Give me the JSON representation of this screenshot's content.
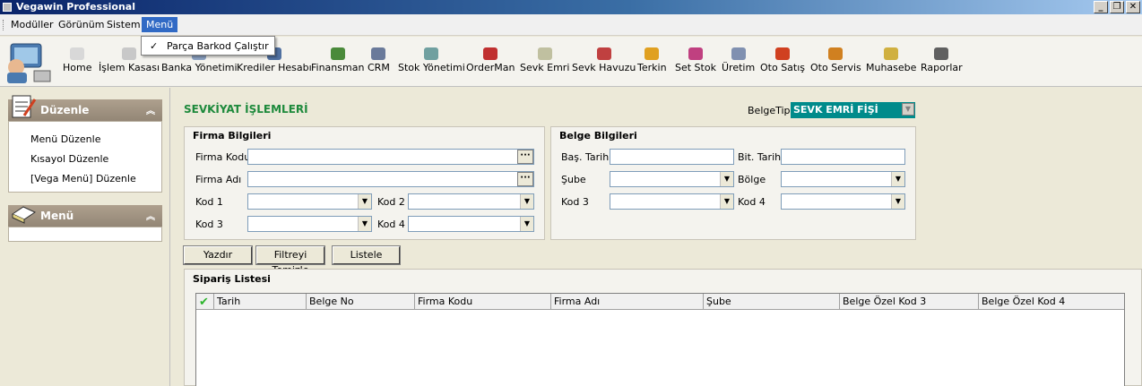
{
  "window": {
    "title": "Vegawin Professional",
    "minimize": "_",
    "restore": "❐",
    "close": "✕"
  },
  "menubar": {
    "items": [
      "Modüller",
      "Görünüm",
      "Sistem",
      "Menü"
    ]
  },
  "dropdown": {
    "items": [
      {
        "label": "Parça Barkod Çalıştır",
        "checked": "✓"
      }
    ]
  },
  "toolbar": {
    "items": [
      {
        "label": "Home",
        "icon": "home-icon",
        "color": "#d8d8d8"
      },
      {
        "label": "İşlem Kasası",
        "icon": "cash-register-icon",
        "color": "#c8c8c8"
      },
      {
        "label": "Banka Yönetimi",
        "icon": "bank-icon",
        "color": "#8aa0c0"
      },
      {
        "label": "Krediler Hesabı",
        "icon": "credit-icon",
        "color": "#5070a0"
      },
      {
        "label": "Finansman",
        "icon": "finance-icon",
        "color": "#4a8a3a"
      },
      {
        "label": "CRM",
        "icon": "crm-icon",
        "color": "#6a7a9a"
      },
      {
        "label": "Stok Yönetimi",
        "icon": "stock-icon",
        "color": "#70a0a0"
      },
      {
        "label": "OrderMan",
        "icon": "orderman-icon",
        "color": "#c03030"
      },
      {
        "label": "Sevk Emri",
        "icon": "dispatch-order-icon",
        "color": "#c0c0a0"
      },
      {
        "label": "Sevk Havuzu",
        "icon": "dispatch-pool-icon",
        "color": "#c04040"
      },
      {
        "label": "Terkin",
        "icon": "terkin-icon",
        "color": "#e0a020"
      },
      {
        "label": "Set Stok",
        "icon": "set-stock-icon",
        "color": "#c04080"
      },
      {
        "label": "Üretim",
        "icon": "production-icon",
        "color": "#8090b0"
      },
      {
        "label": "Oto Satış",
        "icon": "car-sales-icon",
        "color": "#d04020"
      },
      {
        "label": "Oto Servis",
        "icon": "car-service-icon",
        "color": "#d08020"
      },
      {
        "label": "Muhasebe",
        "icon": "accounting-icon",
        "color": "#d0b040"
      },
      {
        "label": "Raporlar",
        "icon": "reports-icon",
        "color": "#606060"
      }
    ]
  },
  "sidebar": {
    "sections": [
      {
        "title": "Düzenle",
        "chevron": "︽",
        "links": [
          "Menü Düzenle",
          "Kısayol Düzenle",
          "[Vega Menü] Düzenle"
        ]
      },
      {
        "title": "Menü",
        "chevron": "︽",
        "links": []
      }
    ]
  },
  "main": {
    "title": "SEVKİYAT İŞLEMLERİ",
    "belge_tipi": {
      "label": "BelgeTipi",
      "value": "SEVK EMRİ FİŞİ"
    },
    "firma": {
      "title": "Firma Bilgileri",
      "firma_kodu": "Firma Kodu",
      "firma_adi": "Firma Adı",
      "kod1": "Kod 1",
      "kod2": "Kod 2",
      "kod3": "Kod 3",
      "kod4": "Kod 4",
      "dots": "···"
    },
    "belge": {
      "title": "Belge Bilgileri",
      "bas_tarih": "Baş. Tarih",
      "bit_tarih": "Bit. Tarih",
      "sube": "Şube",
      "bolge": "Bölge",
      "kod3": "Kod 3",
      "kod4": "Kod 4"
    },
    "buttons": {
      "yazdir": "Yazdır",
      "filtre": "Filtreyi Temizle",
      "listele": "Listele"
    },
    "list": {
      "title": "Sipariş Listesi",
      "check": "✔",
      "columns": [
        "Tarih",
        "Belge No",
        "Firma Kodu",
        "Firma Adı",
        "Şube",
        "Belge Özel Kod 3",
        "Belge Özel Kod 4"
      ]
    }
  },
  "colors": {
    "accent": "#316ac5",
    "title_green": "#1e8a3c",
    "belge_tipi_bg": "#008b8b"
  }
}
